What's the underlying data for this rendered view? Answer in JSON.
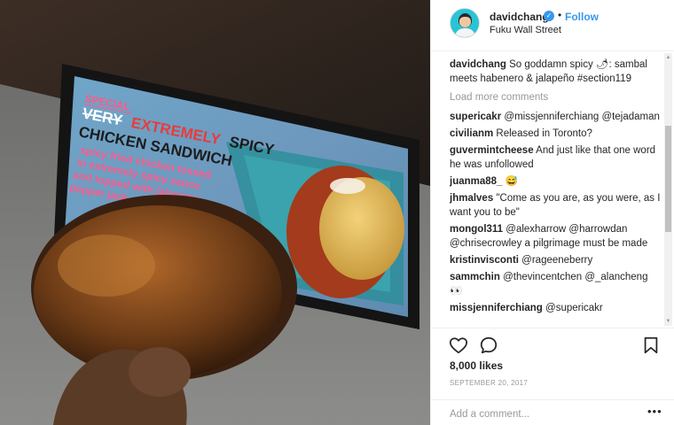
{
  "post": {
    "username": "davidchang",
    "follow_label": "Follow",
    "separator": "•",
    "location": "Fuku Wall Street",
    "verified_glyph": "✓"
  },
  "photo": {
    "sign_special": "SPECIAL",
    "sign_title_strike": "VERY",
    "sign_title_emph": "EXTREMELY",
    "sign_title_rest": "SPICY",
    "sign_title_line2": "CHICKEN SANDWICH",
    "sign_desc": [
      "spicy fried chicken tossed",
      "in extremely spicy sauce",
      "and topped with jalapeno",
      "pepper jack cheese $9"
    ]
  },
  "caption": {
    "user": "davidchang",
    "text": "So goddamn spicy 🌶: sambal meets habenero & jalapeño #section119"
  },
  "load_more": "Load more comments",
  "comments": [
    {
      "user": "supericakr",
      "text": "@missjenniferchiang @tejadaman"
    },
    {
      "user": "civilianm",
      "text": "Released in Toronto?"
    },
    {
      "user": "guvermintcheese",
      "text": "And just like that one word he was unfollowed"
    },
    {
      "user": "juanma88_",
      "text": "😅"
    },
    {
      "user": "jhmalves",
      "text": "\"Come as you are, as you were, as I want you to be\""
    },
    {
      "user": "mongol311",
      "text": "@alexharrow @harrowdan @chrisecrowley a pilgrimage must be made"
    },
    {
      "user": "kristinvisconti",
      "text": "@rageeneberry"
    },
    {
      "user": "sammchin",
      "text": "@thevincentchen @_alancheng 👀"
    },
    {
      "user": "missjenniferchiang",
      "text": "@supericakr"
    }
  ],
  "likes": "8,000 likes",
  "date": "SEPTEMBER 20, 2017",
  "add_comment_placeholder": "Add a comment...",
  "more_dots": "•••",
  "icons": {
    "like": "heart-outline-icon",
    "comment": "comment-bubble-icon",
    "save": "bookmark-icon"
  },
  "colors": {
    "accent": "#3897f0",
    "sign_red": "#e83c3c",
    "sign_pink": "#ff5a8a"
  }
}
